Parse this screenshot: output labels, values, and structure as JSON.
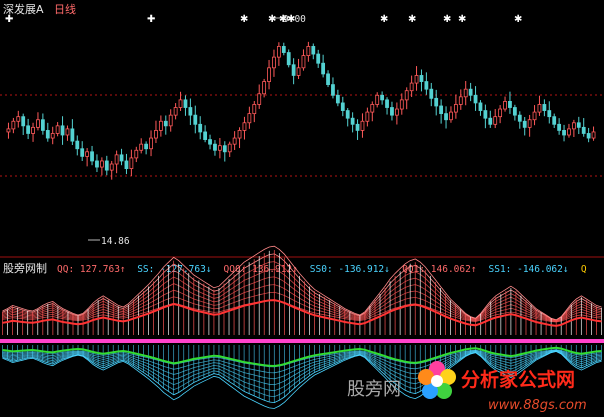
{
  "colors": {
    "background": "#000000",
    "up_candle": "#ff5a5a",
    "down_candle": "#54d2d2",
    "price_grid": "#b41414",
    "panel_border": "#a01010",
    "header_text": "#e6e6e6",
    "ref_bright": "#ff8888",
    "ref_mid": "#ff5555",
    "ref_base": "#ff3333",
    "ref_cyan": "#4ad4ff",
    "ref_green": "#33dd33",
    "zero_line": "#ff44cc",
    "watermark_text": "#aaaaaa",
    "logo_red": "#ff2a1a",
    "url_text": "#e64b2b"
  },
  "header": {
    "symbol": "深发展A",
    "period": "日线"
  },
  "price_panel": {
    "high_label": "9.00",
    "low_label": "14.86",
    "marker_glyphs": [
      "✚",
      "✚",
      "✱",
      "✱",
      "✱",
      "✱",
      "✱",
      "✱",
      "✱",
      "✱",
      "✱",
      "✱",
      "✱",
      "✱",
      "✱",
      "✱",
      "✱"
    ],
    "marker_x": [
      5,
      147,
      240,
      268,
      279,
      287,
      380,
      408,
      443,
      458,
      514
    ]
  },
  "indicator": {
    "name": "股旁网制",
    "fields": [
      {
        "label": "QQ:",
        "value": "127.763",
        "dir": "↑",
        "color": "#ff6a6a"
      },
      {
        "label": "SS:",
        "value": "-127.763",
        "dir": "↓",
        "color": "#4ad4ff"
      },
      {
        "label": "QQ0:",
        "value": "136.912",
        "dir": "↑",
        "color": "#ff6a6a"
      },
      {
        "label": "SS0:",
        "value": "-136.912",
        "dir": "↓",
        "color": "#4ad4ff"
      },
      {
        "label": "QQ1:",
        "value": "146.062",
        "dir": "↑",
        "color": "#ff6a6a"
      },
      {
        "label": "SS1:",
        "value": "-146.062",
        "dir": "↓",
        "color": "#4ad4ff"
      },
      {
        "label": "Q",
        "value": "",
        "dir": "",
        "color": "#ffcc00"
      }
    ]
  },
  "watermark": {
    "cn_text": "股旁网",
    "logo_text": "分析家公式网",
    "url_text": "www.88gs.com"
  },
  "chart_data": {
    "type": "candlestick",
    "title": "",
    "series_name": "深发展A 日线",
    "price_ylim": [
      8.2,
      15.6
    ],
    "candle_count": 120,
    "close": [
      12.1,
      12.35,
      12.5,
      12.2,
      11.95,
      12.15,
      12.4,
      12.05,
      11.8,
      11.95,
      12.2,
      11.9,
      12.1,
      11.7,
      11.45,
      11.2,
      11.35,
      11.05,
      10.85,
      11.05,
      10.75,
      10.95,
      11.25,
      11.05,
      10.8,
      11.15,
      11.4,
      11.6,
      11.45,
      11.8,
      12.05,
      12.35,
      12.2,
      12.55,
      12.8,
      13.05,
      12.8,
      12.55,
      12.25,
      12.0,
      11.75,
      11.6,
      11.4,
      11.55,
      11.35,
      11.6,
      11.8,
      12.05,
      12.3,
      12.6,
      12.9,
      13.25,
      13.65,
      14.1,
      14.45,
      14.8,
      14.6,
      14.2,
      13.85,
      14.1,
      14.5,
      14.8,
      14.55,
      14.25,
      13.9,
      13.55,
      13.2,
      12.95,
      12.7,
      12.45,
      12.25,
      12.05,
      12.35,
      12.65,
      12.9,
      13.2,
      13.05,
      12.8,
      12.55,
      12.75,
      13.05,
      13.35,
      13.6,
      13.85,
      13.65,
      13.4,
      13.1,
      12.85,
      12.6,
      12.4,
      12.65,
      12.9,
      13.15,
      13.4,
      13.2,
      12.95,
      12.7,
      12.45,
      12.25,
      12.5,
      12.75,
      13.0,
      12.8,
      12.55,
      12.35,
      12.15,
      12.4,
      12.65,
      12.9,
      12.7,
      12.5,
      12.25,
      12.05,
      11.9,
      12.1,
      12.3,
      12.15,
      11.95,
      11.8,
      12.0
    ],
    "zero_value": 0,
    "indicator_series": [
      {
        "name": "QQ",
        "value": 127.763
      },
      {
        "name": "SS",
        "value": -127.763
      },
      {
        "name": "QQ0",
        "value": 136.912
      },
      {
        "name": "SS0",
        "value": -136.912
      },
      {
        "name": "QQ1",
        "value": 146.062
      },
      {
        "name": "SS1",
        "value": -146.062
      }
    ],
    "indicator_envelope": [
      0.15,
      0.18,
      0.22,
      0.2,
      0.18,
      0.16,
      0.15,
      0.18,
      0.22,
      0.25,
      0.27,
      0.22,
      0.18,
      0.15,
      0.12,
      0.1,
      0.12,
      0.18,
      0.25,
      0.3,
      0.34,
      0.3,
      0.26,
      0.22,
      0.2,
      0.24,
      0.3,
      0.36,
      0.42,
      0.48,
      0.55,
      0.62,
      0.7,
      0.76,
      0.82,
      0.78,
      0.72,
      0.66,
      0.6,
      0.56,
      0.52,
      0.48,
      0.44,
      0.46,
      0.52,
      0.58,
      0.64,
      0.7,
      0.76,
      0.8,
      0.84,
      0.88,
      0.92,
      0.95,
      0.96,
      0.92,
      0.86,
      0.78,
      0.7,
      0.62,
      0.55,
      0.48,
      0.42,
      0.38,
      0.34,
      0.3,
      0.26,
      0.22,
      0.18,
      0.15,
      0.12,
      0.1,
      0.14,
      0.22,
      0.3,
      0.38,
      0.46,
      0.55,
      0.62,
      0.68,
      0.74,
      0.78,
      0.8,
      0.76,
      0.7,
      0.62,
      0.54,
      0.46,
      0.38,
      0.3,
      0.24,
      0.18,
      0.12,
      0.08,
      0.06,
      0.12,
      0.2,
      0.28,
      0.34,
      0.38,
      0.42,
      0.46,
      0.42,
      0.36,
      0.3,
      0.24,
      0.18,
      0.14,
      0.1,
      0.06,
      0.04,
      0.08,
      0.16,
      0.24,
      0.3,
      0.34,
      0.3,
      0.26,
      0.22,
      0.2
    ]
  }
}
